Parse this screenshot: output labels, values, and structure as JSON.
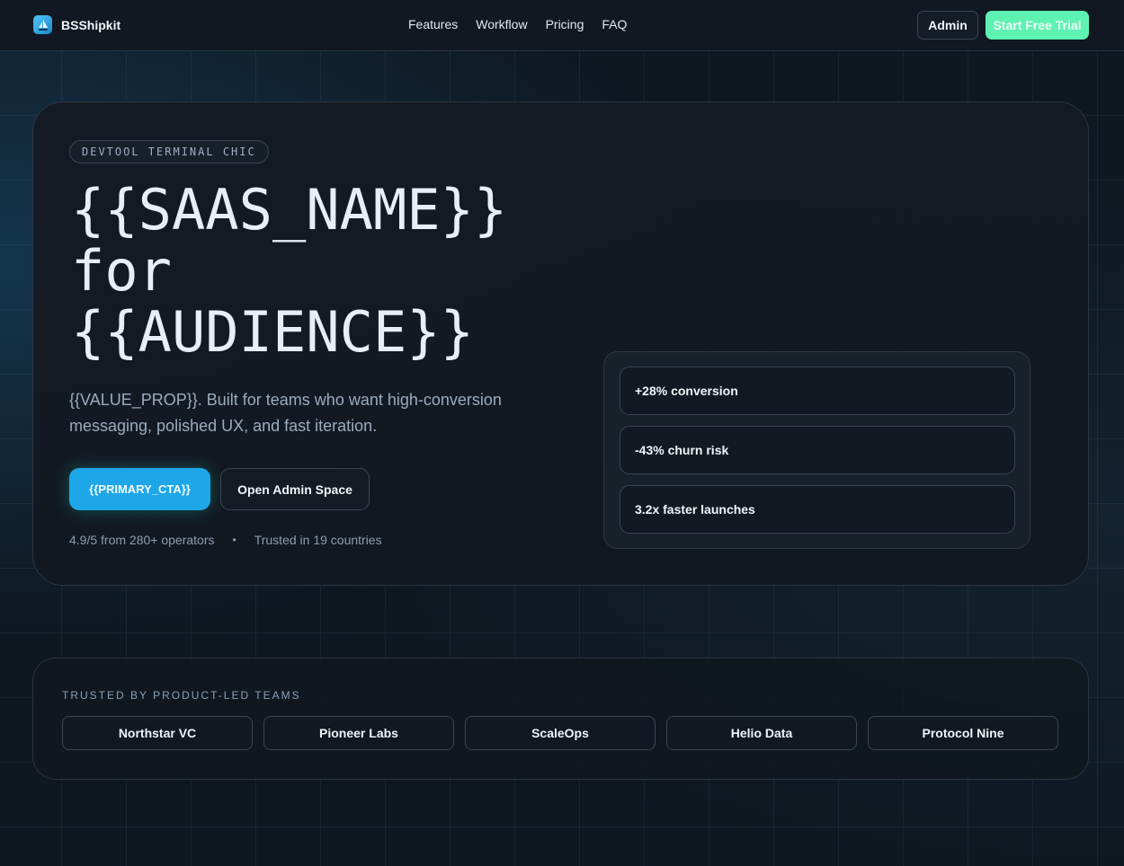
{
  "nav": {
    "brand": "BSShipkit",
    "links": [
      {
        "label": "Features"
      },
      {
        "label": "Workflow"
      },
      {
        "label": "Pricing"
      },
      {
        "label": "FAQ"
      }
    ],
    "admin_label": "Admin",
    "trial_label": "Start Free Trial"
  },
  "hero": {
    "badge": "DEVTOOL TERMINAL CHIC",
    "headline": [
      "{{SAAS_NAME}}",
      "for",
      "{{AUDIENCE}}"
    ],
    "value_prop": "{{VALUE_PROP}}. Built for teams who want high-conversion messaging, polished UX, and fast iteration.",
    "primary_cta": "{{PRIMARY_CTA}}",
    "secondary_cta": "Open Admin Space",
    "rating": "4.9/5 from 280+ operators",
    "separator": "•",
    "trusted_countries": "Trusted in 19 countries",
    "metrics": [
      {
        "label": "+28% conversion"
      },
      {
        "label": "-43% churn risk"
      },
      {
        "label": "3.2x faster launches"
      }
    ]
  },
  "trusted": {
    "title": "TRUSTED BY PRODUCT-LED TEAMS",
    "logos": [
      "Northstar VC",
      "Pioneer Labs",
      "ScaleOps",
      "Helio Data",
      "Protocol Nine"
    ]
  },
  "colors": {
    "accent_primary": "#1ea7e8",
    "accent_trial": "#5ef2b2",
    "background": "#0f1720"
  }
}
